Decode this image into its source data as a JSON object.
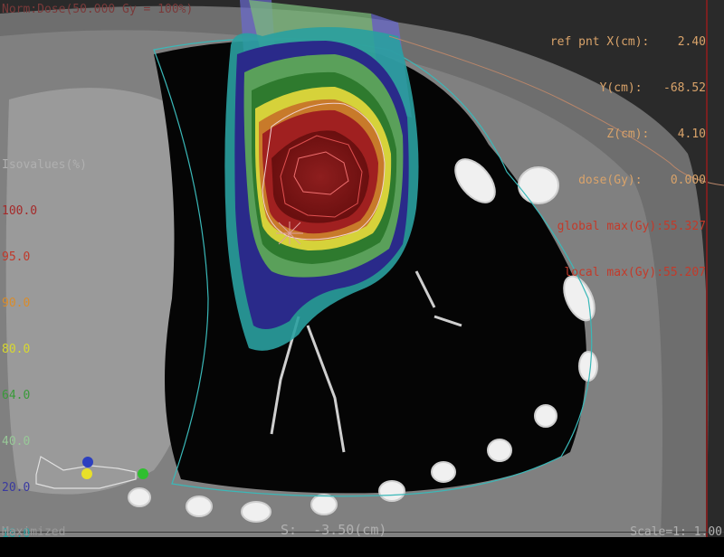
{
  "overlay": {
    "norm": "Norm:Dose(50.000 Gy = 100%)",
    "ref_lines": [
      {
        "text": "ref pnt X(cm):    2.40",
        "color": "#d9a36a"
      },
      {
        "text": "Y(cm):   -68.52",
        "color": "#d9a36a"
      },
      {
        "text": "Z(cm):    4.10",
        "color": "#d9a36a"
      },
      {
        "text": "dose(Gy):    0.000",
        "color": "#d9a36a"
      },
      {
        "text": "global max(Gy):55.327",
        "color": "#c33a2a"
      },
      {
        "text": "local max(Gy):55.207",
        "color": "#c33a2a"
      }
    ],
    "isovalues_title": "Isovalues(%)",
    "isovalues": [
      {
        "value": "100.0",
        "color": "#a52a2a"
      },
      {
        "value": "95.0",
        "color": "#c0392b"
      },
      {
        "value": "90.0",
        "color": "#d98c2b"
      },
      {
        "value": "80.0",
        "color": "#d8d830"
      },
      {
        "value": "64.0",
        "color": "#3a9a3a"
      },
      {
        "value": "40.0",
        "color": "#98c898"
      },
      {
        "value": "20.0",
        "color": "#3a3aa0"
      },
      {
        "value": "10.0",
        "color": "#2aa0a0"
      }
    ],
    "maximized": "Maximized",
    "slice": "S:  -3.50(cm)",
    "scale": "Scale=1: 1.00"
  },
  "colors": {
    "accent_red": "#7a2020",
    "ref_text": "#d9a36a",
    "max_text": "#c33a2a"
  }
}
